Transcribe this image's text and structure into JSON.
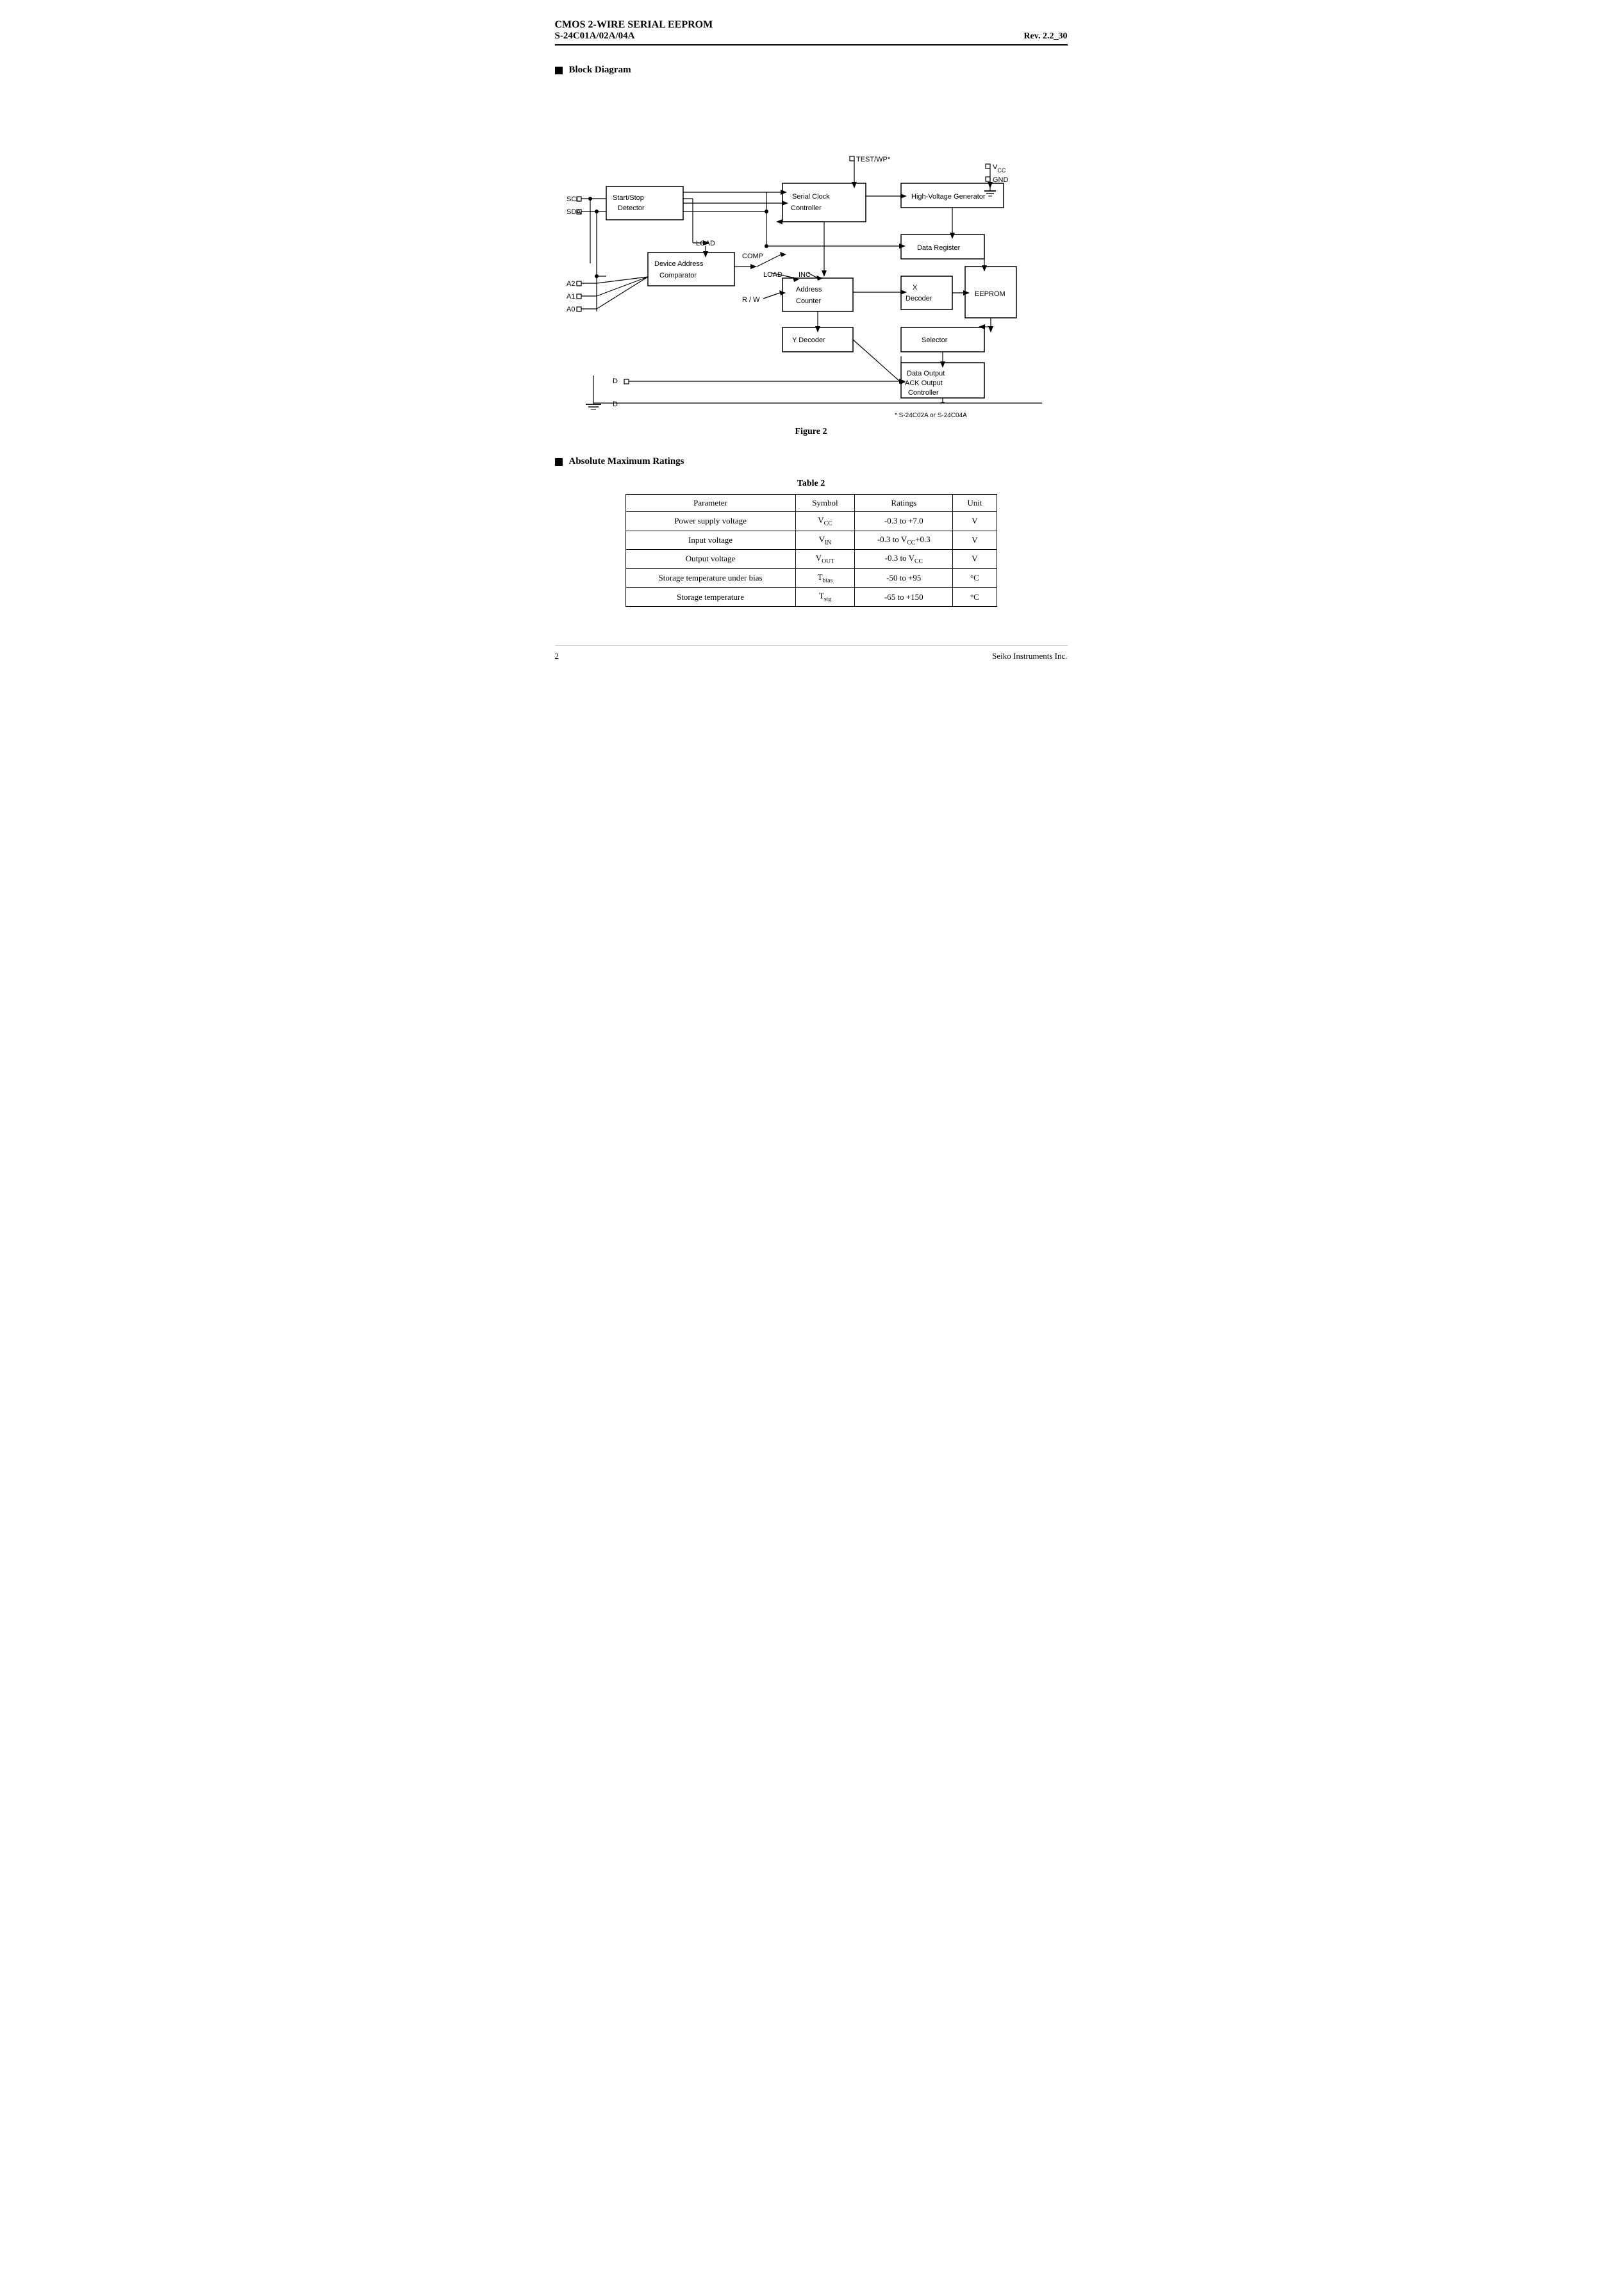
{
  "header": {
    "line1": "CMOS 2-WIRE SERIAL  EEPROM",
    "line2": "S-24C01A/02A/04A",
    "rev": "Rev. 2.2_30"
  },
  "sections": {
    "block_diagram": {
      "title": "Block Diagram",
      "figure_label": "Figure 2",
      "footnote": "*  S-24C02A or S-24C04A"
    },
    "absolute_max": {
      "title": "Absolute Maximum Ratings",
      "table_label": "Table  2",
      "table_headers": [
        "Parameter",
        "Symbol",
        "Ratings",
        "Unit"
      ],
      "table_rows": [
        [
          "Power supply voltage",
          "V_CC",
          "-0.3 to +7.0",
          "V"
        ],
        [
          "Input voltage",
          "V_IN",
          "-0.3 to V_CC+0.3",
          "V"
        ],
        [
          "Output voltage",
          "V_OUT",
          "-0.3 to V_CC",
          "V"
        ],
        [
          "Storage temperature under bias",
          "T_bias",
          "-50 to +95",
          "°C"
        ],
        [
          "Storage temperature",
          "T_stg",
          "-65 to +150",
          "°C"
        ]
      ]
    }
  },
  "footer": {
    "page_number": "2",
    "company": "Seiko Instruments Inc."
  }
}
